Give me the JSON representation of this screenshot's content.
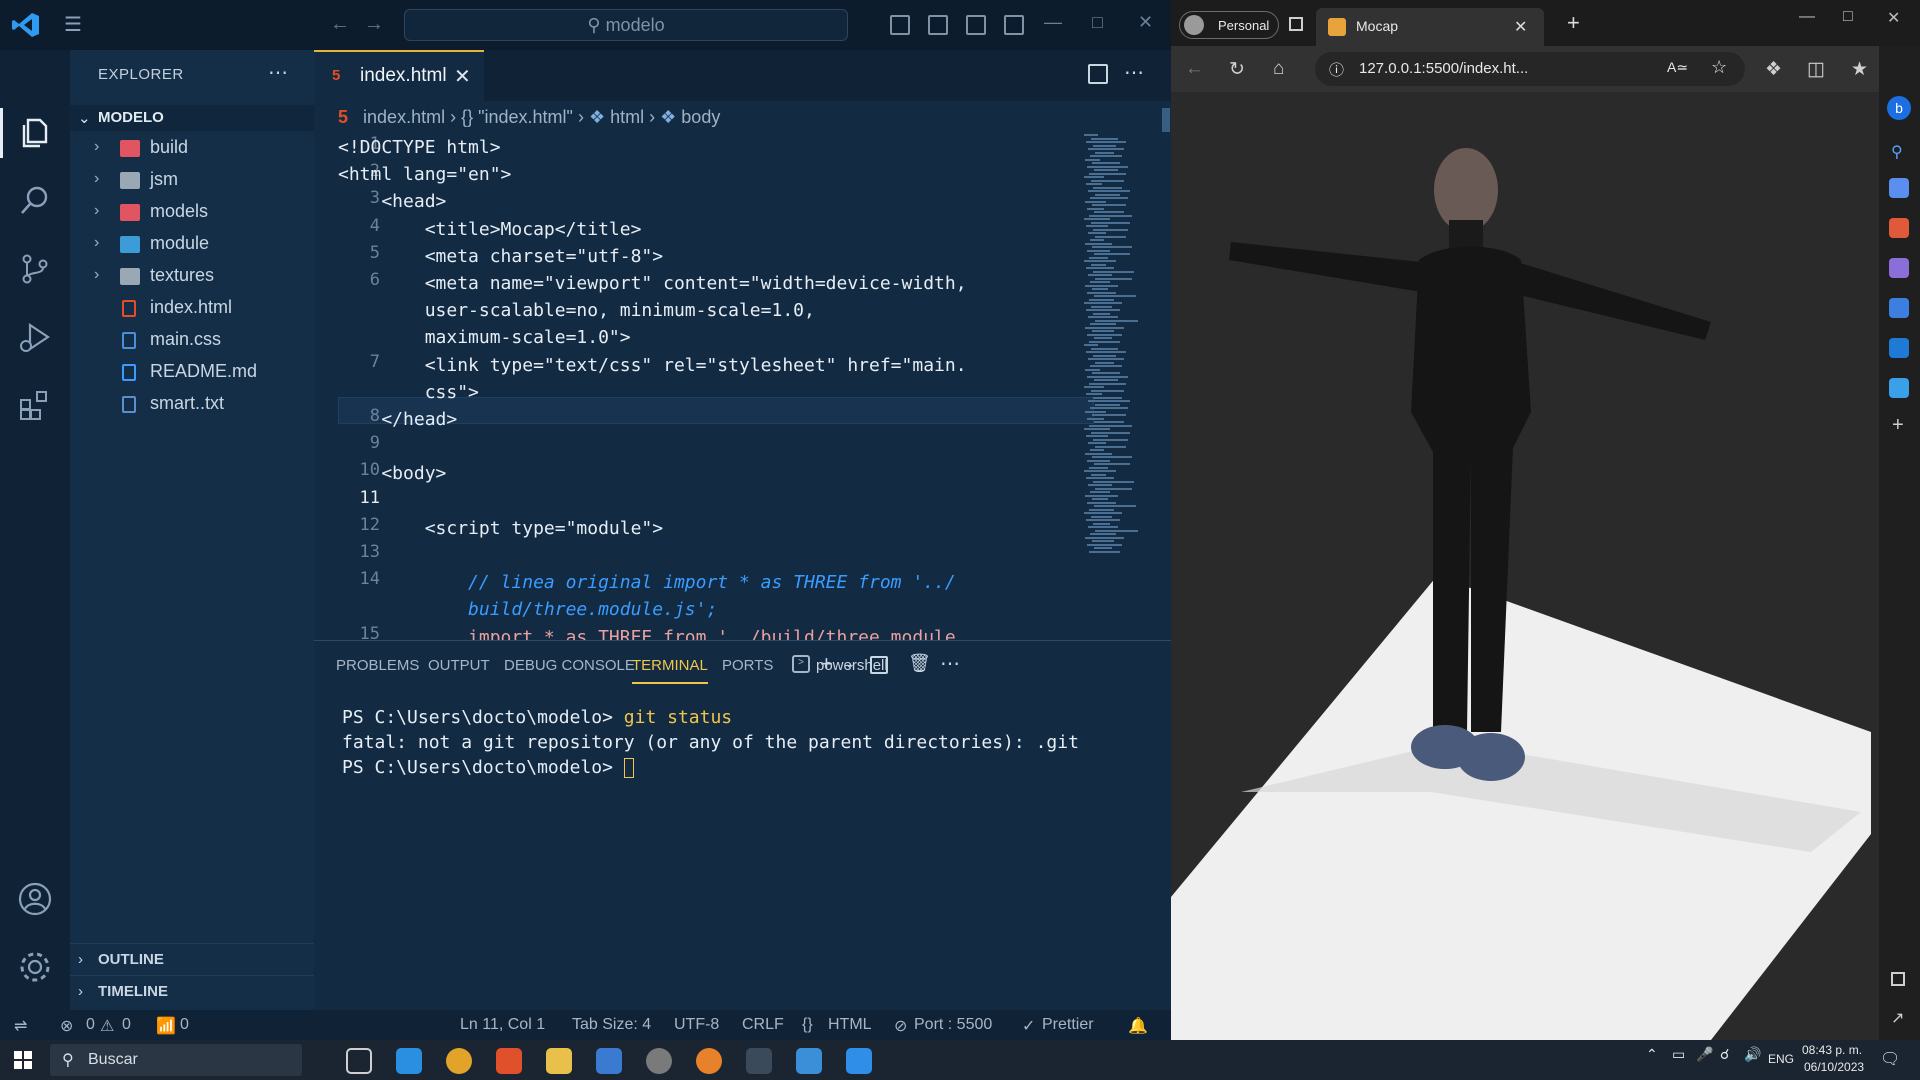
{
  "vscode": {
    "command_search": "modelo",
    "sidebar": {
      "title": "EXPLORER",
      "folder": "MODELO",
      "items": [
        {
          "label": "build",
          "type": "folder",
          "color": "#e05561"
        },
        {
          "label": "jsm",
          "type": "folder",
          "color": "#9aa7b4"
        },
        {
          "label": "models",
          "type": "folder",
          "color": "#e05561"
        },
        {
          "label": "module",
          "type": "folder",
          "color": "#3c9cd7"
        },
        {
          "label": "textures",
          "type": "folder",
          "color": "#9aa7b4"
        },
        {
          "label": "index.html",
          "type": "file",
          "color": "#e44d26"
        },
        {
          "label": "main.css",
          "type": "file",
          "color": "#4a90d9"
        },
        {
          "label": "README.md",
          "type": "file",
          "color": "#3b9cff"
        },
        {
          "label": "smart..txt",
          "type": "file",
          "color": "#5a8fd0"
        }
      ],
      "outline": "OUTLINE",
      "timeline": "TIMELINE"
    },
    "tab": {
      "label": "index.html"
    },
    "breadcrumb": [
      "index.html",
      "{} \"index.html\"",
      "html",
      "body"
    ],
    "line_numbers": [
      "1",
      "2",
      "3",
      "4",
      "5",
      "6",
      "",
      "",
      "7",
      "",
      "8",
      "9",
      "10",
      "11",
      "12",
      "13",
      "14",
      "",
      "15"
    ],
    "code_lines": [
      "<!DOCTYPE html>",
      "<html lang=\"en\">",
      "    <head>",
      "        <title>Mocap</title>",
      "        <meta charset=\"utf-8\">",
      "        <meta name=\"viewport\" content=\"width=device-width,",
      "        user-scalable=no, minimum-scale=1.0,",
      "        maximum-scale=1.0\">",
      "        <link type=\"text/css\" rel=\"stylesheet\" href=\"main.",
      "        css\">",
      "    </head>",
      "",
      "    <body>",
      "",
      "        <script type=\"module\">",
      "",
      "            // linea original import * as THREE from '../",
      "            build/three.module.js';",
      "            import * as THREE from '../build/three.module"
    ],
    "panel_tabs": [
      "PROBLEMS",
      "OUTPUT",
      "DEBUG CONSOLE",
      "TERMINAL",
      "PORTS"
    ],
    "active_panel_tab": "TERMINAL",
    "shell_label": "powershell",
    "terminal": {
      "prompt1": "PS C:\\Users\\docto\\modelo> ",
      "cmd1": "git status",
      "output": "fatal: not a git repository (or any of the parent directories): .git",
      "prompt2": "PS C:\\Users\\docto\\modelo> "
    },
    "status": {
      "errors": "0",
      "warnings": "0",
      "ports_fwd": "0",
      "position": "Ln 11, Col 1",
      "tab_size": "Tab Size: 4",
      "encoding": "UTF-8",
      "eol": "CRLF",
      "language": "HTML",
      "port": "Port : 5500",
      "formatter": "Prettier"
    }
  },
  "edge": {
    "profile": "Personal",
    "tab_title": "Mocap",
    "url": "127.0.0.1:5500/index.ht..."
  },
  "taskbar": {
    "search": "Buscar",
    "lang": "ENG",
    "time": "08:43 p. m.",
    "date": "06/10/2023"
  }
}
